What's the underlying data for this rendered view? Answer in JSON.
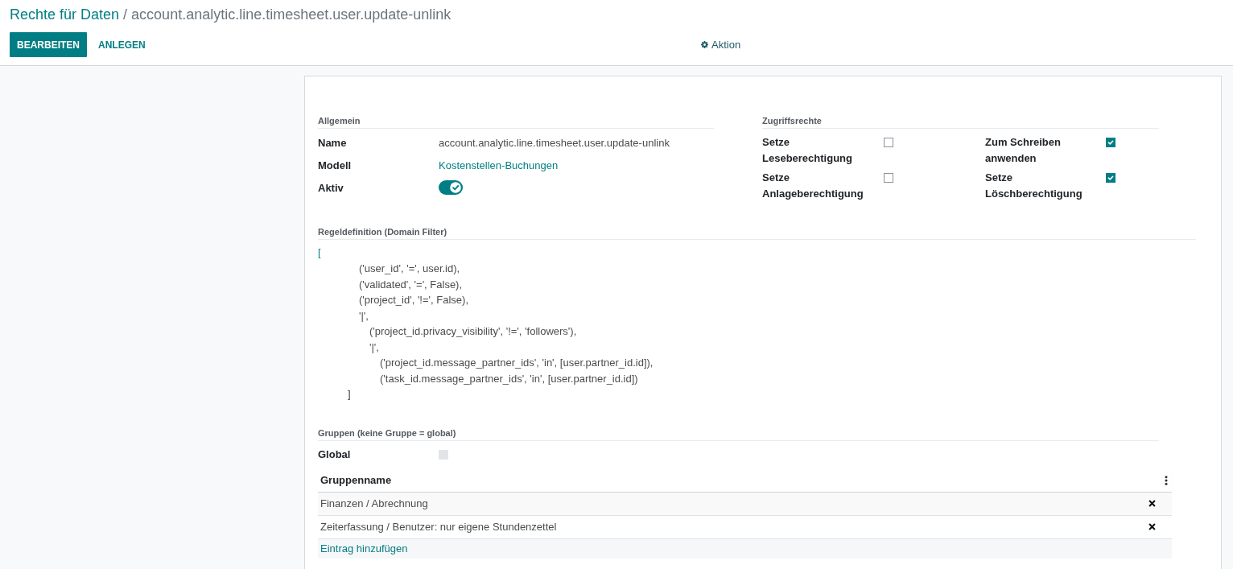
{
  "breadcrumb": {
    "parent": "Rechte für Daten",
    "separator": "/",
    "current": "account.analytic.line.timesheet.user.update-unlink"
  },
  "toolbar": {
    "edit_button": "BEARBEITEN",
    "create_button": "ANLEGEN",
    "action_menu": "Aktion"
  },
  "general": {
    "title": "Allgemein",
    "fields": [
      {
        "label": "Name",
        "kind": "text",
        "value": "account.analytic.line.timesheet.user.update-unlink"
      },
      {
        "label": "Modell",
        "kind": "link",
        "value": "Kostenstellen-Buchungen"
      },
      {
        "label": "Aktiv",
        "kind": "toggle",
        "on": true
      }
    ]
  },
  "access_rights": {
    "title": "Zugriffsrechte",
    "items": [
      {
        "label": "Setze Leseberechtigung",
        "checked": false
      },
      {
        "label": "Zum Schreiben anwenden",
        "checked": true
      },
      {
        "label": "Setze Anlageberechtigung",
        "checked": false
      },
      {
        "label": "Setze Löschberechtigung",
        "checked": true
      }
    ]
  },
  "domain": {
    "title": "Regeldefinition (Domain Filter)",
    "open": "[",
    "items": [
      {
        "text": "('user_id', '=', user.id),"
      },
      {
        "text": "('validated', '=', False),"
      },
      {
        "text": "('project_id', '!=', False),"
      },
      {
        "text": "'|',",
        "children": [
          {
            "text": "('project_id.privacy_visibility', '!=', 'followers'),"
          },
          {
            "text": "'|',",
            "children": [
              {
                "text": "('project_id.message_partner_ids', 'in', [user.partner_id.id]),"
              },
              {
                "text": "('task_id.message_partner_ids', 'in', [user.partner_id.id])"
              }
            ]
          }
        ]
      }
    ],
    "close": "]"
  },
  "groups": {
    "title": "Gruppen (keine Gruppe = global)",
    "global": {
      "label": "Global",
      "checked": false,
      "disabled": true
    },
    "table": {
      "columns": [
        "Gruppenname"
      ],
      "rows": [
        {
          "name": "Finanzen / Abrechnung"
        },
        {
          "name": "Zeiterfassung / Benutzer: nur eigene Stundenzettel"
        }
      ],
      "add_line": "Eintrag hinzufügen"
    }
  }
}
